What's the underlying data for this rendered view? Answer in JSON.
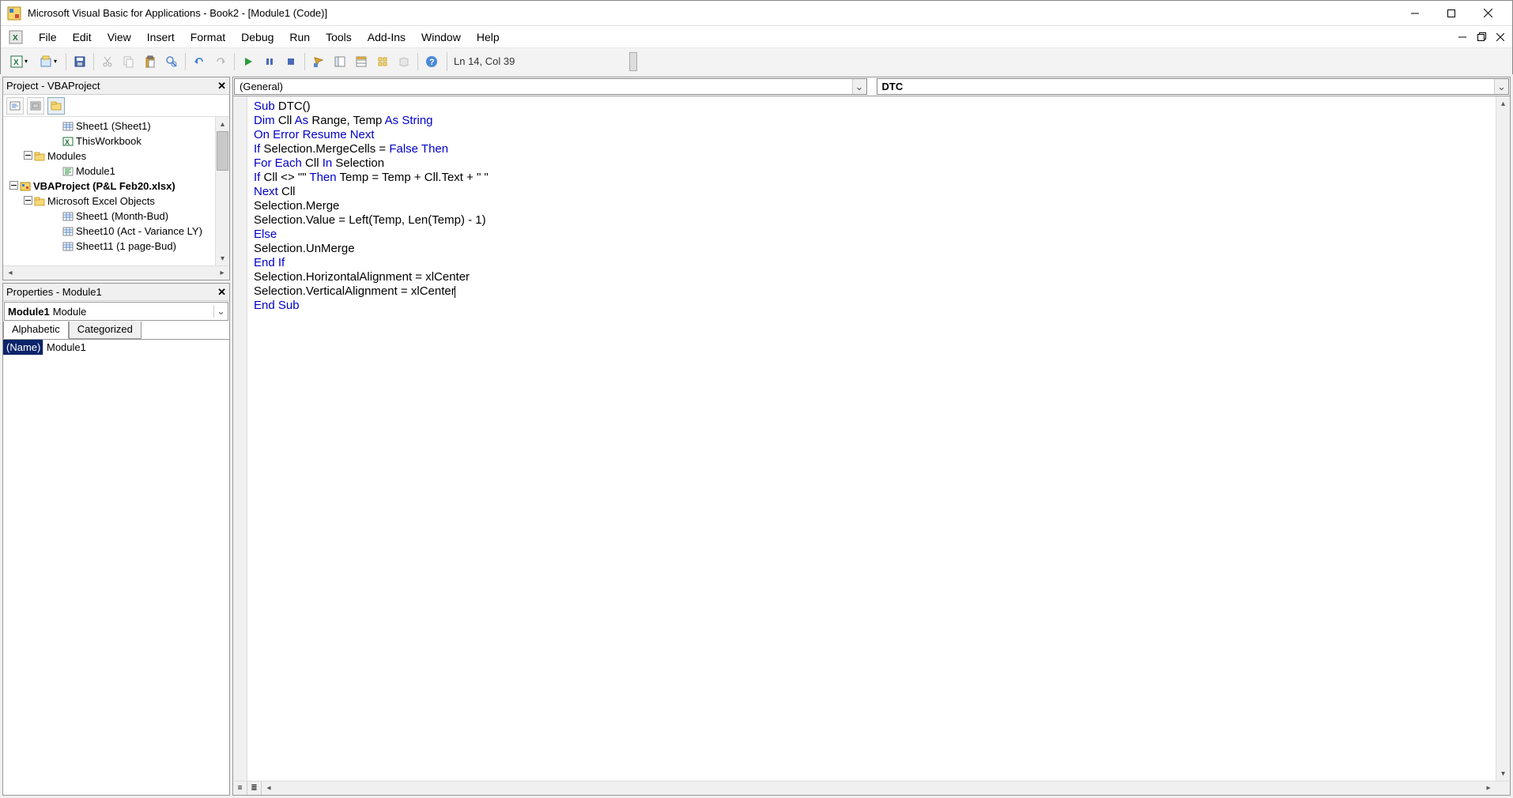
{
  "title": "Microsoft Visual Basic for Applications - Book2 - [Module1 (Code)]",
  "menus": [
    "File",
    "Edit",
    "View",
    "Insert",
    "Format",
    "Debug",
    "Run",
    "Tools",
    "Add-Ins",
    "Window",
    "Help"
  ],
  "status": "Ln 14, Col 39",
  "project": {
    "title": "Project - VBAProject",
    "tree": [
      {
        "indent": 3,
        "icon": "sheet",
        "label": "Sheet1 (Sheet1)"
      },
      {
        "indent": 3,
        "icon": "wb",
        "label": "ThisWorkbook"
      },
      {
        "indent": 1,
        "twist": "-",
        "icon": "folder",
        "label": "Modules"
      },
      {
        "indent": 3,
        "icon": "mod",
        "label": "Module1"
      },
      {
        "indent": 0,
        "twist": "-",
        "icon": "vba",
        "bold": true,
        "label": "VBAProject (P&L Feb20.xlsx)"
      },
      {
        "indent": 1,
        "twist": "-",
        "icon": "folder",
        "label": "Microsoft Excel Objects"
      },
      {
        "indent": 3,
        "icon": "sheet",
        "label": "Sheet1 (Month-Bud)"
      },
      {
        "indent": 3,
        "icon": "sheet",
        "label": "Sheet10 (Act - Variance LY)"
      },
      {
        "indent": 3,
        "icon": "sheet",
        "label": "Sheet11 (1 page-Bud)"
      }
    ]
  },
  "properties": {
    "title": "Properties - Module1",
    "object": "Module1",
    "objectType": "Module",
    "tabs": [
      "Alphabetic",
      "Categorized"
    ],
    "rows": [
      {
        "name": "(Name)",
        "value": "Module1"
      }
    ]
  },
  "code": {
    "leftDropdown": "(General)",
    "rightDropdown": "DTC",
    "lines": [
      [
        {
          "t": "Sub ",
          "c": "kw"
        },
        {
          "t": "DTC()"
        }
      ],
      [
        {
          "t": "Dim ",
          "c": "kw"
        },
        {
          "t": "Cll "
        },
        {
          "t": "As ",
          "c": "kw"
        },
        {
          "t": "Range, Temp "
        },
        {
          "t": "As String",
          "c": "kw"
        }
      ],
      [
        {
          "t": "On Error Resume Next",
          "c": "kw"
        }
      ],
      [
        {
          "t": "If ",
          "c": "kw"
        },
        {
          "t": "Selection.MergeCells = "
        },
        {
          "t": "False Then",
          "c": "kw"
        }
      ],
      [
        {
          "t": "For Each ",
          "c": "kw"
        },
        {
          "t": "Cll "
        },
        {
          "t": "In ",
          "c": "kw"
        },
        {
          "t": "Selection"
        }
      ],
      [
        {
          "t": "If ",
          "c": "kw"
        },
        {
          "t": "Cll <> \"\" "
        },
        {
          "t": "Then ",
          "c": "kw"
        },
        {
          "t": "Temp = Temp + Cll.Text + \" \""
        }
      ],
      [
        {
          "t": "Next ",
          "c": "kw"
        },
        {
          "t": "Cll"
        }
      ],
      [
        {
          "t": "Selection.Merge"
        }
      ],
      [
        {
          "t": "Selection.Value = Left(Temp, Len(Temp) - 1)"
        }
      ],
      [
        {
          "t": "Else",
          "c": "kw"
        }
      ],
      [
        {
          "t": "Selection.UnMerge"
        }
      ],
      [
        {
          "t": "End If",
          "c": "kw"
        }
      ],
      [
        {
          "t": "Selection.HorizontalAlignment = xlCenter"
        }
      ],
      [
        {
          "t": "Selection.VerticalAlignment = xlCenter"
        },
        {
          "caret": true
        }
      ],
      [
        {
          "t": "End Sub",
          "c": "kw"
        }
      ]
    ]
  }
}
